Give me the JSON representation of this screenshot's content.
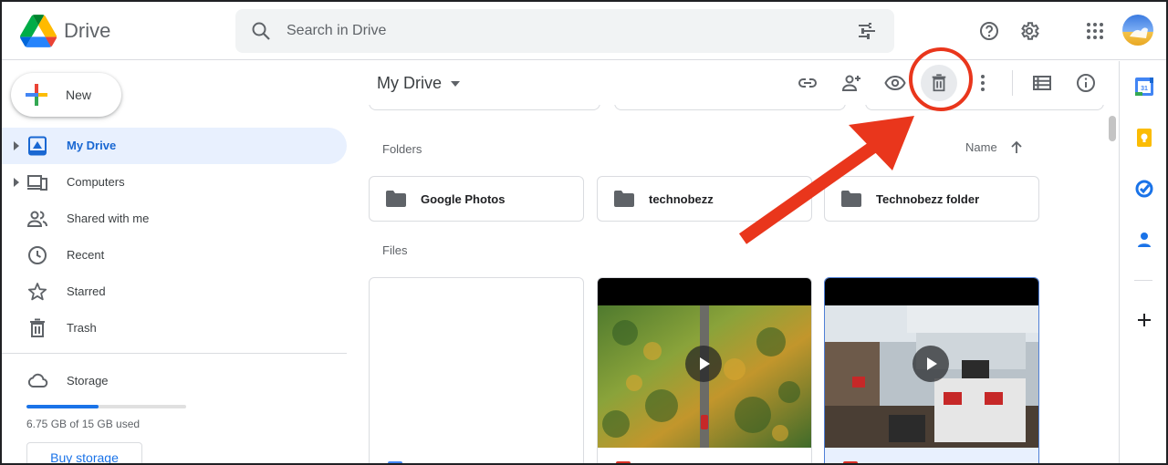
{
  "header": {
    "app_title": "Drive",
    "search_placeholder": "Search in Drive"
  },
  "sidebar": {
    "new_label": "New",
    "items": [
      {
        "label": "My Drive",
        "icon": "my-drive-icon",
        "active": true
      },
      {
        "label": "Computers",
        "icon": "computers-icon"
      },
      {
        "label": "Shared with me",
        "icon": "shared-icon"
      },
      {
        "label": "Recent",
        "icon": "clock-icon"
      },
      {
        "label": "Starred",
        "icon": "star-icon"
      },
      {
        "label": "Trash",
        "icon": "trash-icon"
      }
    ],
    "storage": {
      "label": "Storage",
      "used_text": "6.75 GB of 15 GB used",
      "used_fraction": 0.45,
      "buy_label": "Buy storage"
    }
  },
  "toolbar": {
    "breadcrumb": "My Drive"
  },
  "main": {
    "folders_label": "Folders",
    "files_label": "Files",
    "sort_label": "Name",
    "folders": [
      {
        "name": "Google Photos"
      },
      {
        "name": "technobezz"
      },
      {
        "name": "Technobezz folder"
      }
    ]
  },
  "colors": {
    "accent": "#1a73e8",
    "active_bg": "#e8f0fe",
    "annotation": "#e9361c"
  }
}
